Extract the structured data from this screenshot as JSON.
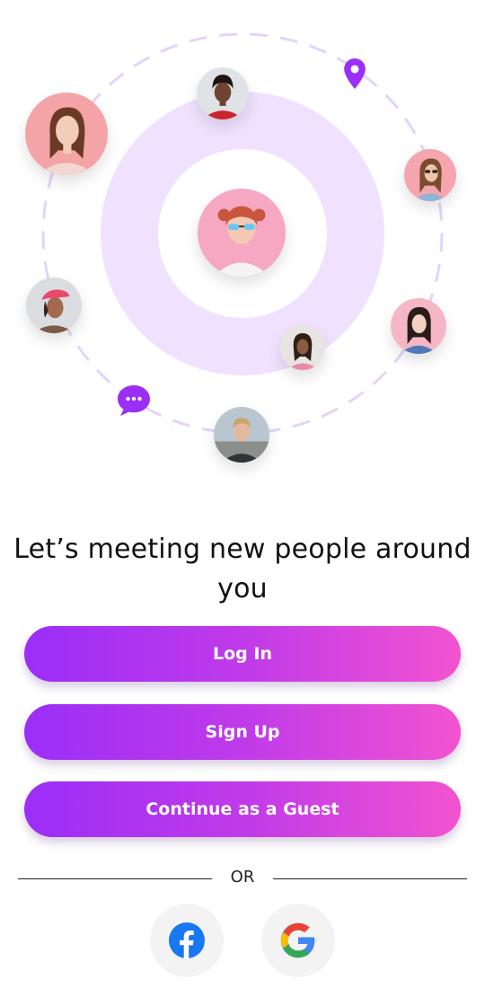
{
  "headline": {
    "line1": "Let’s meeting new people around",
    "line2": "you"
  },
  "buttons": {
    "login": "Log In",
    "signup": "Sign Up",
    "guest": "Continue as a Guest"
  },
  "divider": {
    "label": "OR"
  },
  "social": [
    {
      "name": "facebook",
      "icon": "facebook-icon"
    },
    {
      "name": "google",
      "icon": "google-icon"
    }
  ],
  "colors": {
    "gradient_start": "#9b2ef7",
    "gradient_end": "#f253d0",
    "ring": "#efe0ff",
    "dash": "#e4d4fb",
    "accent": "#9b2ef7"
  }
}
